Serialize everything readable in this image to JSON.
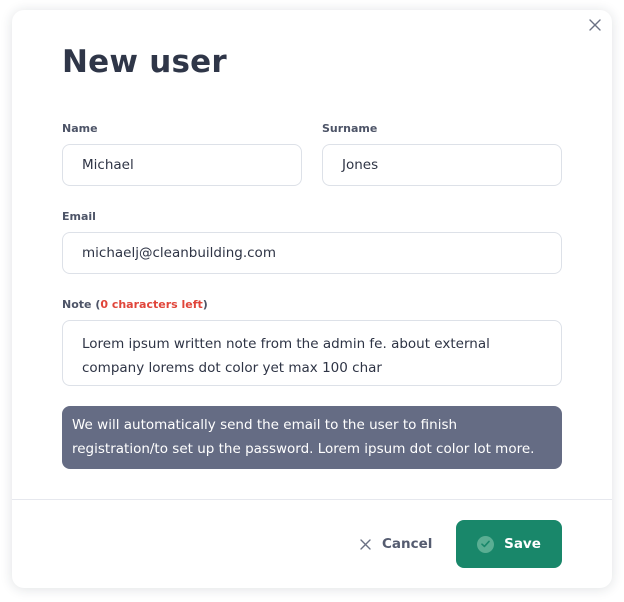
{
  "dialog": {
    "title": "New user"
  },
  "form": {
    "name": {
      "label": "Name",
      "value": "Michael"
    },
    "surname": {
      "label": "Surname",
      "value": "Jones"
    },
    "email": {
      "label": "Email",
      "value": "michaelj@cleanbuilding.com"
    },
    "note": {
      "label": "Note",
      "label_open": " (",
      "characters_left": "0 characters left",
      "label_close": ")",
      "value": "Lorem ipsum written note from the admin fe. about external company lorems dot color yet max 100 char"
    }
  },
  "info": {
    "text": "We will automatically send the email to the user to finish registration/to set up the password. Lorem ipsum dot color lot more."
  },
  "actions": {
    "cancel_label": "Cancel",
    "save_label": "Save"
  },
  "icons": {
    "close": "close-icon",
    "cancel": "x-icon",
    "save": "check-circle-icon"
  },
  "colors": {
    "primary": "#19876a",
    "info_background": "#656c84",
    "warning_text": "#e0453a"
  }
}
